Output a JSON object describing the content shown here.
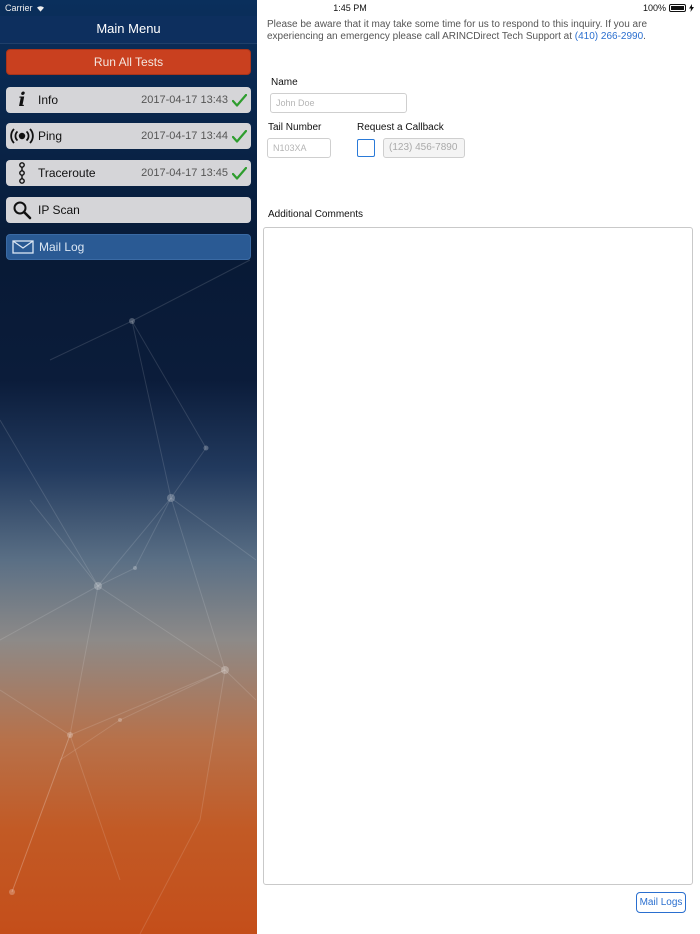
{
  "status_bar": {
    "carrier": "Carrier",
    "time": "1:45 PM",
    "battery": "100%",
    "battery_level": 1.0
  },
  "sidebar": {
    "title": "Main Menu",
    "run_all_label": "Run All Tests",
    "items": [
      {
        "label": "Info",
        "time": "2017-04-17 13:43",
        "icon": "info-icon",
        "checked": true
      },
      {
        "label": "Ping",
        "time": "2017-04-17 13:44",
        "icon": "ping-icon",
        "checked": true
      },
      {
        "label": "Traceroute",
        "time": "2017-04-17 13:45",
        "icon": "traceroute-icon",
        "checked": true
      },
      {
        "label": "IP Scan",
        "time": "",
        "icon": "search-icon",
        "checked": false
      },
      {
        "label": "Mail Log",
        "time": "",
        "icon": "mail-icon",
        "checked": false,
        "active": true
      }
    ]
  },
  "main": {
    "notice_text": "Please be aware that it may take some time for us to respond to this inquiry. If you are experiencing an emergency please call ARINCDirect Tech Support at ",
    "notice_phone": "(410) 266-2990",
    "notice_end": ".",
    "name_label": "Name",
    "name_placeholder": "John Doe",
    "tail_label": "Tail Number",
    "tail_placeholder": "N103XA",
    "callback_label": "Request a Callback",
    "callback_placeholder": "(123) 456-7890",
    "comments_label": "Additional Comments",
    "mail_logs_label": "Mail Logs"
  },
  "colors": {
    "accent": "#2a6fcf",
    "run_all": "#c9401f",
    "check": "#2e9d2e"
  }
}
